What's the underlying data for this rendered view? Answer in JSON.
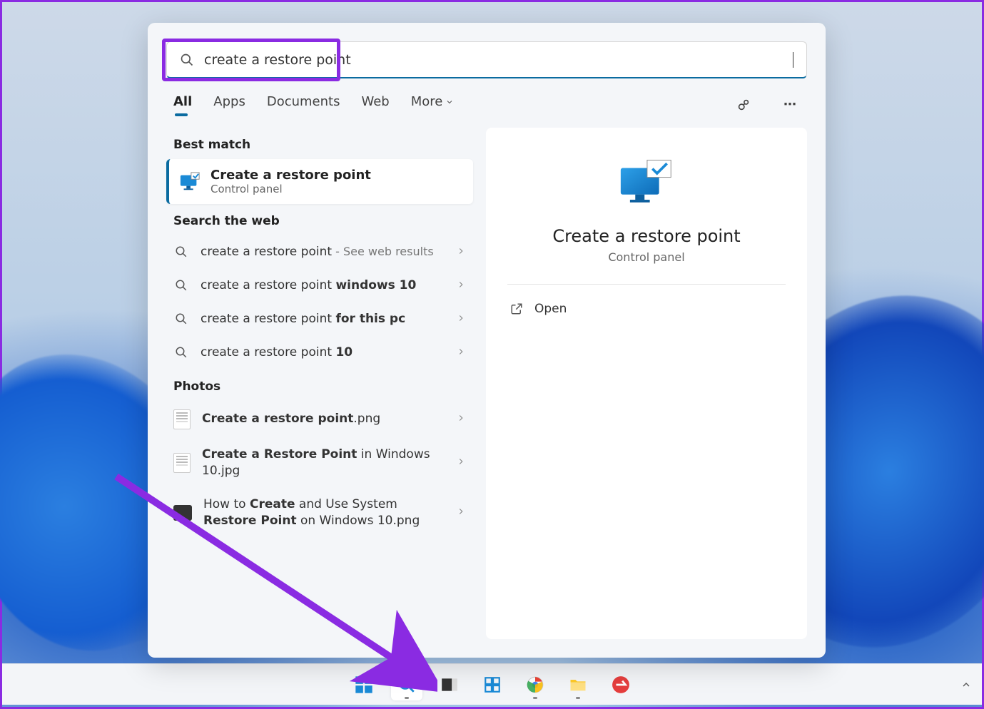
{
  "search": {
    "query": "create a restore point"
  },
  "tabs": {
    "all": "All",
    "apps": "Apps",
    "documents": "Documents",
    "web": "Web",
    "more": "More"
  },
  "headers": {
    "best": "Best match",
    "web": "Search the web",
    "photos": "Photos"
  },
  "bestMatch": {
    "title": "Create a restore point",
    "subtitle": "Control panel"
  },
  "webResults": [
    {
      "prefix": "create a restore point",
      "bold": "",
      "suffix": " - See web results"
    },
    {
      "prefix": "create a restore point ",
      "bold": "windows 10",
      "suffix": ""
    },
    {
      "prefix": "create a restore point ",
      "bold": "for this pc",
      "suffix": ""
    },
    {
      "prefix": "create a restore point ",
      "bold": "10",
      "suffix": ""
    }
  ],
  "photoResults": [
    {
      "pre": "",
      "bold": "Create a restore point",
      "post": ".png"
    },
    {
      "pre": "",
      "bold": "Create a Restore Point",
      "post": " in Windows 10.jpg"
    },
    {
      "pre": "How to ",
      "bold": "Create",
      "mid": " and Use System ",
      "bold2": "Restore Point",
      "post": " on Windows 10.png"
    }
  ],
  "detail": {
    "title": "Create a restore point",
    "subtitle": "Control panel",
    "open": "Open"
  },
  "taskbar": {
    "start": "start",
    "search": "search",
    "task": "task-view",
    "widgets": "widgets",
    "chrome": "chrome",
    "explorer": "explorer",
    "app": "app"
  }
}
